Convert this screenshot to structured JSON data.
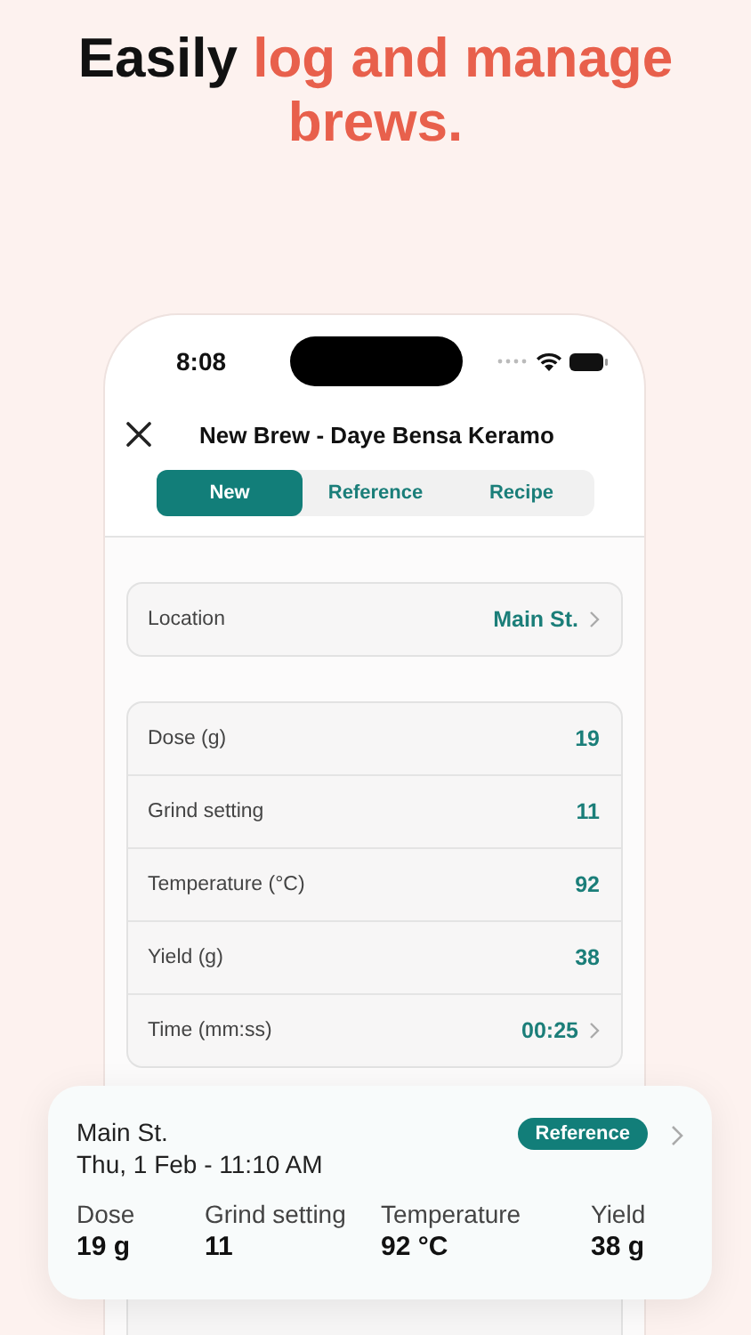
{
  "headline": {
    "lead": "Easily",
    "accent": "log and manage brews."
  },
  "status_bar": {
    "time": "8:08"
  },
  "nav": {
    "title": "New Brew - Daye Bensa Keramo"
  },
  "segments": [
    {
      "label": "New",
      "selected": true
    },
    {
      "label": "Reference",
      "selected": false
    },
    {
      "label": "Recipe",
      "selected": false
    }
  ],
  "location": {
    "label": "Location",
    "value": "Main St.",
    "chevron": true
  },
  "fields": [
    {
      "label": "Dose (g)",
      "value": "19",
      "chevron": false
    },
    {
      "label": "Grind setting",
      "value": "11",
      "chevron": false
    },
    {
      "label": "Temperature (°C)",
      "value": "92",
      "chevron": false
    },
    {
      "label": "Yield (g)",
      "value": "38",
      "chevron": false
    },
    {
      "label": "Time (mm:ss)",
      "value": "00:25",
      "chevron": true
    }
  ],
  "reference_card": {
    "location": "Main St.",
    "datetime": "Thu, 1 Feb - 11:10 AM",
    "badge": "Reference",
    "stats": [
      {
        "label": "Dose",
        "value": "19 g"
      },
      {
        "label": "Grind setting",
        "value": "11"
      },
      {
        "label": "Temperature",
        "value": "92 °C"
      },
      {
        "label": "Yield",
        "value": "38 g"
      }
    ]
  }
}
